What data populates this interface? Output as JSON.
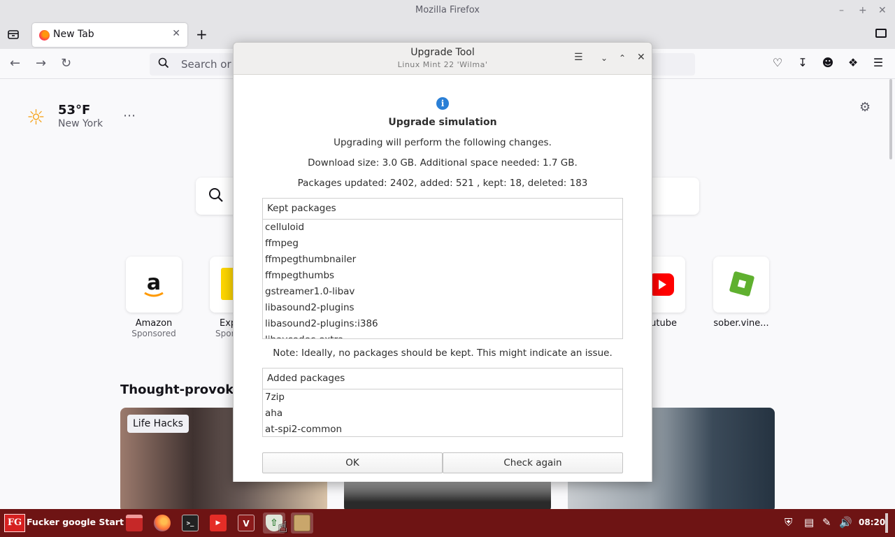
{
  "window": {
    "title": "Mozilla Firefox"
  },
  "tabs": [
    {
      "label": "New Tab"
    }
  ],
  "urlbar": {
    "placeholder": "Search or e"
  },
  "newtab": {
    "weather": {
      "temp": "53°F",
      "city": "New York"
    },
    "tiles": [
      {
        "name": "Amazon",
        "sub": "Sponsored"
      },
      {
        "name": "Exp",
        "sub": "Spon"
      },
      {
        "name": "utube",
        "sub": ""
      },
      {
        "name": "sober.vine...",
        "sub": ""
      }
    ],
    "section_title": "Thought-provoki",
    "story_badge": "Life Hacks"
  },
  "dialog": {
    "title": "Upgrade Tool",
    "subtitle": "Linux Mint 22 'Wilma'",
    "heading": "Upgrade simulation",
    "line1": "Upgrading will perform the following changes.",
    "line2": "Download size: 3.0 GB. Additional space needed: 1.7 GB.",
    "line3": "Packages updated: 2402, added: 521 , kept: 18, deleted: 183",
    "kept_header": "Kept packages",
    "kept": [
      "celluloid",
      "ffmpeg",
      "ffmpegthumbnailer",
      "ffmpegthumbs",
      "gstreamer1.0-libav",
      "libasound2-plugins",
      "libasound2-plugins:i386",
      "libavcodec-extra"
    ],
    "note": "Note: Ideally, no packages should be kept. This might indicate an issue.",
    "added_header": "Added packages",
    "added": [
      "7zip",
      "aha",
      "at-spi2-common"
    ],
    "ok_label": "OK",
    "check_label": "Check again"
  },
  "taskbar": {
    "start_logo": "FG",
    "start_label": "Fucker google Start",
    "clock": "08:20",
    "apps": [
      "file-manager",
      "firefox",
      "terminal",
      "youtube",
      "app-v",
      "upgrade-tool",
      "archive"
    ]
  },
  "colors": {
    "taskbar": "#6e1414",
    "accent": "#2a7fd6"
  }
}
